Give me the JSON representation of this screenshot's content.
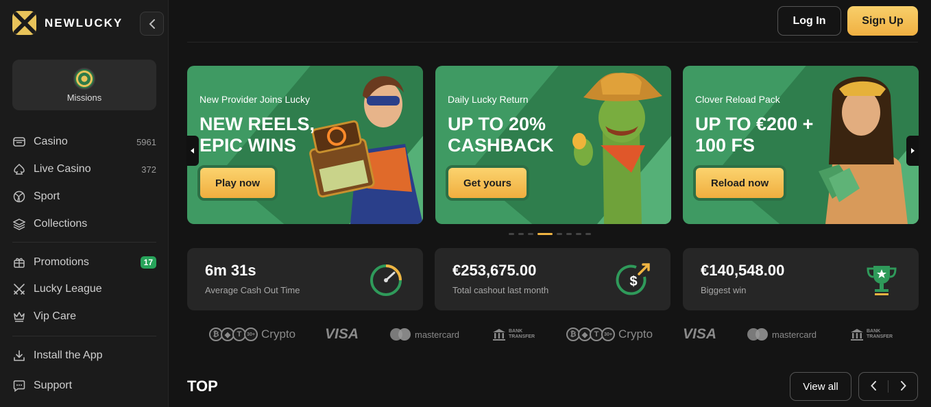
{
  "brand": {
    "name": "NEWLUCKY"
  },
  "sidebar": {
    "collapse_icon": "chevron-left-icon",
    "missions": {
      "label": "Missions",
      "icon": "target-icon"
    },
    "nav_primary": [
      {
        "label": "Casino",
        "count": "5961",
        "icon": "slot-icon"
      },
      {
        "label": "Live Casino",
        "count": "372",
        "icon": "club-icon"
      },
      {
        "label": "Sport",
        "count": "",
        "icon": "ball-icon"
      },
      {
        "label": "Collections",
        "count": "",
        "icon": "layers-icon"
      }
    ],
    "nav_secondary": [
      {
        "label": "Promotions",
        "badge": "17",
        "icon": "gift-icon"
      },
      {
        "label": "Lucky League",
        "icon": "swords-icon"
      },
      {
        "label": "Vip Care",
        "icon": "crown-icon"
      }
    ],
    "nav_tertiary": [
      {
        "label": "Install the App",
        "icon": "download-icon"
      },
      {
        "label": "Support",
        "icon": "chat-icon"
      }
    ]
  },
  "header": {
    "login": "Log In",
    "signup": "Sign Up"
  },
  "banners": [
    {
      "subtitle": "New Provider Joins Lucky",
      "headline": "NEW REELS, EPIC WINS",
      "cta": "Play now"
    },
    {
      "subtitle": "Daily Lucky Return",
      "headline": "UP TO 20% CASHBACK",
      "cta": "Get yours"
    },
    {
      "subtitle": "Clover Reload Pack",
      "headline": "UP TO €200 + 100 FS",
      "cta": "Reload now"
    }
  ],
  "carousel": {
    "dot_count": 8,
    "active_index": 3
  },
  "stats": [
    {
      "value": "6m 31s",
      "label": "Average Cash Out Time",
      "icon": "gauge-icon"
    },
    {
      "value": "€253,675.00",
      "label": "Total cashout last month",
      "icon": "dollar-arrow-icon"
    },
    {
      "value": "€140,548.00",
      "label": "Biggest win",
      "icon": "trophy-icon"
    }
  ],
  "payments": {
    "crypto": "Crypto",
    "crypto_more": "30+",
    "visa": "VISA",
    "mastercard": "mastercard",
    "bank_line1": "BANK",
    "bank_line2": "TRANSFER"
  },
  "section": {
    "title": "TOP",
    "view_all": "View all"
  },
  "colors": {
    "accent": "#f0b442",
    "green": "#3f9a63",
    "badge": "#27a35a",
    "background": "#141414"
  }
}
